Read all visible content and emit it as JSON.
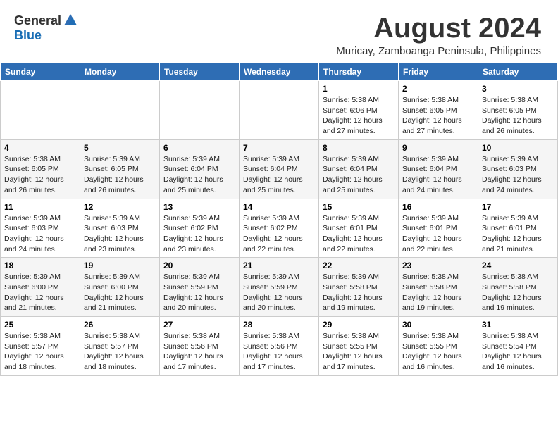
{
  "header": {
    "logo_general": "General",
    "logo_blue": "Blue",
    "month_year": "August 2024",
    "location": "Muricay, Zamboanga Peninsula, Philippines"
  },
  "weekdays": [
    "Sunday",
    "Monday",
    "Tuesday",
    "Wednesday",
    "Thursday",
    "Friday",
    "Saturday"
  ],
  "weeks": [
    [
      {
        "day": "",
        "detail": ""
      },
      {
        "day": "",
        "detail": ""
      },
      {
        "day": "",
        "detail": ""
      },
      {
        "day": "",
        "detail": ""
      },
      {
        "day": "1",
        "detail": "Sunrise: 5:38 AM\nSunset: 6:06 PM\nDaylight: 12 hours\nand 27 minutes."
      },
      {
        "day": "2",
        "detail": "Sunrise: 5:38 AM\nSunset: 6:05 PM\nDaylight: 12 hours\nand 27 minutes."
      },
      {
        "day": "3",
        "detail": "Sunrise: 5:38 AM\nSunset: 6:05 PM\nDaylight: 12 hours\nand 26 minutes."
      }
    ],
    [
      {
        "day": "4",
        "detail": "Sunrise: 5:38 AM\nSunset: 6:05 PM\nDaylight: 12 hours\nand 26 minutes."
      },
      {
        "day": "5",
        "detail": "Sunrise: 5:39 AM\nSunset: 6:05 PM\nDaylight: 12 hours\nand 26 minutes."
      },
      {
        "day": "6",
        "detail": "Sunrise: 5:39 AM\nSunset: 6:04 PM\nDaylight: 12 hours\nand 25 minutes."
      },
      {
        "day": "7",
        "detail": "Sunrise: 5:39 AM\nSunset: 6:04 PM\nDaylight: 12 hours\nand 25 minutes."
      },
      {
        "day": "8",
        "detail": "Sunrise: 5:39 AM\nSunset: 6:04 PM\nDaylight: 12 hours\nand 25 minutes."
      },
      {
        "day": "9",
        "detail": "Sunrise: 5:39 AM\nSunset: 6:04 PM\nDaylight: 12 hours\nand 24 minutes."
      },
      {
        "day": "10",
        "detail": "Sunrise: 5:39 AM\nSunset: 6:03 PM\nDaylight: 12 hours\nand 24 minutes."
      }
    ],
    [
      {
        "day": "11",
        "detail": "Sunrise: 5:39 AM\nSunset: 6:03 PM\nDaylight: 12 hours\nand 24 minutes."
      },
      {
        "day": "12",
        "detail": "Sunrise: 5:39 AM\nSunset: 6:03 PM\nDaylight: 12 hours\nand 23 minutes."
      },
      {
        "day": "13",
        "detail": "Sunrise: 5:39 AM\nSunset: 6:02 PM\nDaylight: 12 hours\nand 23 minutes."
      },
      {
        "day": "14",
        "detail": "Sunrise: 5:39 AM\nSunset: 6:02 PM\nDaylight: 12 hours\nand 22 minutes."
      },
      {
        "day": "15",
        "detail": "Sunrise: 5:39 AM\nSunset: 6:01 PM\nDaylight: 12 hours\nand 22 minutes."
      },
      {
        "day": "16",
        "detail": "Sunrise: 5:39 AM\nSunset: 6:01 PM\nDaylight: 12 hours\nand 22 minutes."
      },
      {
        "day": "17",
        "detail": "Sunrise: 5:39 AM\nSunset: 6:01 PM\nDaylight: 12 hours\nand 21 minutes."
      }
    ],
    [
      {
        "day": "18",
        "detail": "Sunrise: 5:39 AM\nSunset: 6:00 PM\nDaylight: 12 hours\nand 21 minutes."
      },
      {
        "day": "19",
        "detail": "Sunrise: 5:39 AM\nSunset: 6:00 PM\nDaylight: 12 hours\nand 21 minutes."
      },
      {
        "day": "20",
        "detail": "Sunrise: 5:39 AM\nSunset: 5:59 PM\nDaylight: 12 hours\nand 20 minutes."
      },
      {
        "day": "21",
        "detail": "Sunrise: 5:39 AM\nSunset: 5:59 PM\nDaylight: 12 hours\nand 20 minutes."
      },
      {
        "day": "22",
        "detail": "Sunrise: 5:39 AM\nSunset: 5:58 PM\nDaylight: 12 hours\nand 19 minutes."
      },
      {
        "day": "23",
        "detail": "Sunrise: 5:38 AM\nSunset: 5:58 PM\nDaylight: 12 hours\nand 19 minutes."
      },
      {
        "day": "24",
        "detail": "Sunrise: 5:38 AM\nSunset: 5:58 PM\nDaylight: 12 hours\nand 19 minutes."
      }
    ],
    [
      {
        "day": "25",
        "detail": "Sunrise: 5:38 AM\nSunset: 5:57 PM\nDaylight: 12 hours\nand 18 minutes."
      },
      {
        "day": "26",
        "detail": "Sunrise: 5:38 AM\nSunset: 5:57 PM\nDaylight: 12 hours\nand 18 minutes."
      },
      {
        "day": "27",
        "detail": "Sunrise: 5:38 AM\nSunset: 5:56 PM\nDaylight: 12 hours\nand 17 minutes."
      },
      {
        "day": "28",
        "detail": "Sunrise: 5:38 AM\nSunset: 5:56 PM\nDaylight: 12 hours\nand 17 minutes."
      },
      {
        "day": "29",
        "detail": "Sunrise: 5:38 AM\nSunset: 5:55 PM\nDaylight: 12 hours\nand 17 minutes."
      },
      {
        "day": "30",
        "detail": "Sunrise: 5:38 AM\nSunset: 5:55 PM\nDaylight: 12 hours\nand 16 minutes."
      },
      {
        "day": "31",
        "detail": "Sunrise: 5:38 AM\nSunset: 5:54 PM\nDaylight: 12 hours\nand 16 minutes."
      }
    ]
  ]
}
